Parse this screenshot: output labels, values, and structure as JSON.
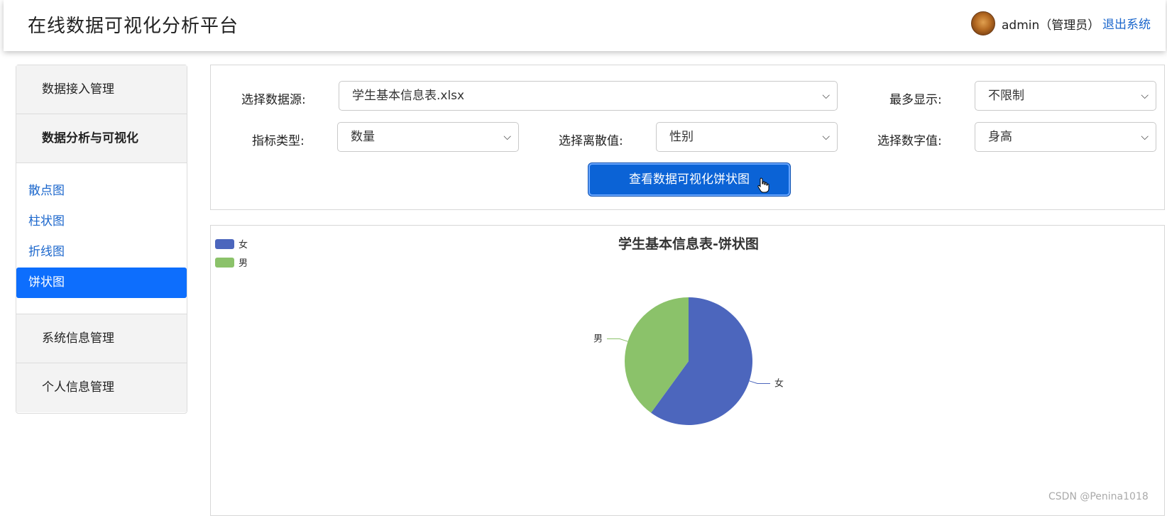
{
  "header": {
    "title": "在线数据可视化分析平台",
    "user": "admin（管理员）",
    "logout": "退出系统"
  },
  "sidebar": {
    "groups": [
      {
        "label": "数据接入管理"
      },
      {
        "label": "数据分析与可视化"
      },
      {
        "label": "系统信息管理"
      },
      {
        "label": "个人信息管理"
      }
    ],
    "items": [
      {
        "label": "散点图",
        "active": false
      },
      {
        "label": "柱状图",
        "active": false
      },
      {
        "label": "折线图",
        "active": false
      },
      {
        "label": "饼状图",
        "active": true
      }
    ]
  },
  "controls": {
    "datasource_label": "选择数据源:",
    "datasource_value": "学生基本信息表.xlsx",
    "max_label": "最多显示:",
    "max_value": "不限制",
    "metric_label": "指标类型:",
    "metric_value": "数量",
    "discrete_label": "选择离散值:",
    "discrete_value": "性别",
    "numeric_label": "选择数字值:",
    "numeric_value": "身高",
    "button": "查看数据可视化饼状图"
  },
  "colors": {
    "accent": "#0d6efd",
    "female": "#4c66bd",
    "male": "#8bc26a"
  },
  "chart_data": {
    "type": "pie",
    "title": "学生基本信息表-饼状图",
    "legend": [
      "女",
      "男"
    ],
    "legend_position": "top-left",
    "slices": [
      {
        "label": "女",
        "value": 0.6
      },
      {
        "label": "男",
        "value": 0.4
      }
    ]
  },
  "watermark": "CSDN @Penina1018"
}
